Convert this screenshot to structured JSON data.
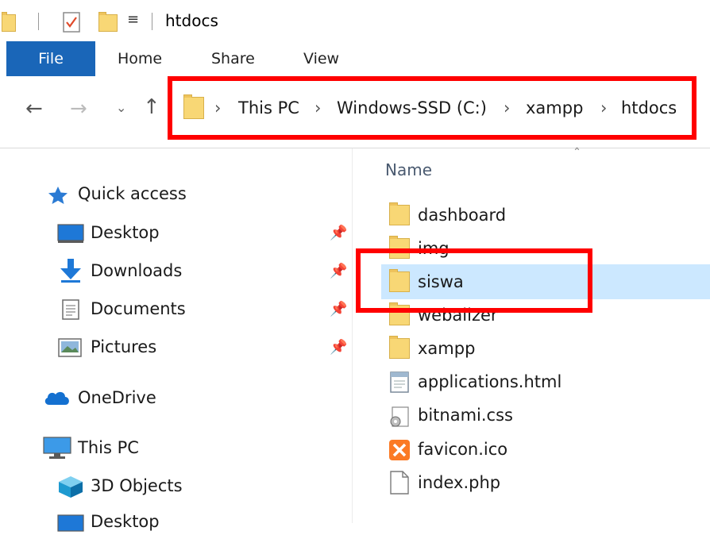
{
  "titlebar": {
    "title": "htdocs"
  },
  "ribbon": {
    "tabs": [
      "File",
      "Home",
      "Share",
      "View"
    ]
  },
  "address": {
    "crumbs": [
      "This PC",
      "Windows-SSD (C:)",
      "xampp",
      "htdocs"
    ]
  },
  "columns": {
    "name_header": "Name"
  },
  "sidebar": {
    "quick_access": "Quick access",
    "items": [
      {
        "label": "Desktop",
        "icon": "desktop-icon",
        "pinned": true
      },
      {
        "label": "Downloads",
        "icon": "downloads-icon",
        "pinned": true
      },
      {
        "label": "Documents",
        "icon": "documents-icon",
        "pinned": true
      },
      {
        "label": "Pictures",
        "icon": "pictures-icon",
        "pinned": true
      }
    ],
    "onedrive": "OneDrive",
    "this_pc": "This PC",
    "this_pc_items": [
      "3D Objects",
      "Desktop"
    ]
  },
  "files": [
    {
      "name": "dashboard",
      "type": "folder"
    },
    {
      "name": "img",
      "type": "folder"
    },
    {
      "name": "siswa",
      "type": "folder",
      "selected": true
    },
    {
      "name": "webalizer",
      "type": "folder"
    },
    {
      "name": "xampp",
      "type": "folder"
    },
    {
      "name": "applications.html",
      "type": "html"
    },
    {
      "name": "bitnami.css",
      "type": "css"
    },
    {
      "name": "favicon.ico",
      "type": "ico"
    },
    {
      "name": "index.php",
      "type": "php"
    }
  ],
  "colors": {
    "accent": "#1a66b8",
    "selection": "#cce8ff",
    "highlight": "#ff0000",
    "folder": "#f8d775"
  }
}
